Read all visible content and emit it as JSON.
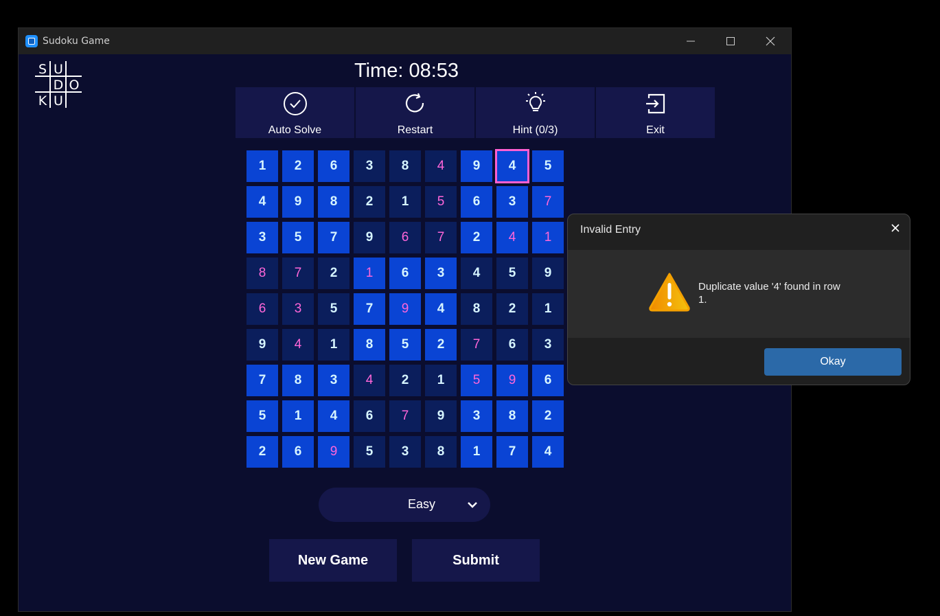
{
  "window": {
    "title": "Sudoku Game"
  },
  "logo": {
    "letters": [
      "S",
      "U",
      "D",
      "O",
      "K",
      "U"
    ]
  },
  "timer": {
    "text": "Time: 08:53"
  },
  "toolbar": {
    "auto_solve": "Auto Solve",
    "restart": "Restart",
    "hint": "Hint (0/3)",
    "exit": "Exit"
  },
  "board": {
    "selected_cell": {
      "row": 1,
      "col": 8
    },
    "rows": [
      [
        "1",
        "2",
        "6",
        "3",
        "8",
        "4",
        "9",
        "4",
        "5"
      ],
      [
        "4",
        "9",
        "8",
        "2",
        "1",
        "5",
        "6",
        "3",
        "7"
      ],
      [
        "3",
        "5",
        "7",
        "9",
        "6",
        "7",
        "2",
        "4",
        "1"
      ],
      [
        "8",
        "7",
        "2",
        "1",
        "6",
        "3",
        "4",
        "5",
        "9"
      ],
      [
        "6",
        "3",
        "5",
        "7",
        "9",
        "4",
        "8",
        "2",
        "1"
      ],
      [
        "9",
        "4",
        "1",
        "8",
        "5",
        "2",
        "7",
        "6",
        "3"
      ],
      [
        "7",
        "8",
        "3",
        "4",
        "2",
        "1",
        "5",
        "9",
        "6"
      ],
      [
        "5",
        "1",
        "4",
        "6",
        "7",
        "9",
        "3",
        "8",
        "2"
      ],
      [
        "2",
        "6",
        "9",
        "5",
        "3",
        "8",
        "1",
        "7",
        "4"
      ]
    ],
    "cell_types": [
      [
        "g",
        "g",
        "g",
        "d",
        "d",
        "u",
        "g",
        "g",
        "g"
      ],
      [
        "g",
        "g",
        "g",
        "d",
        "d",
        "u",
        "g",
        "g",
        "gu"
      ],
      [
        "g",
        "g",
        "g",
        "d",
        "u",
        "u",
        "g",
        "gu",
        "gu"
      ],
      [
        "u",
        "u",
        "d",
        "gu",
        "g",
        "g",
        "d",
        "d",
        "d"
      ],
      [
        "u",
        "u",
        "d",
        "g",
        "gu",
        "g",
        "d",
        "d",
        "d"
      ],
      [
        "d",
        "u",
        "d",
        "g",
        "g",
        "g",
        "u",
        "d",
        "d"
      ],
      [
        "g",
        "g",
        "g",
        "u",
        "d",
        "d",
        "gu",
        "gu",
        "g"
      ],
      [
        "g",
        "g",
        "g",
        "d",
        "u",
        "d",
        "g",
        "g",
        "g"
      ],
      [
        "g",
        "g",
        "gu",
        "d",
        "d",
        "d",
        "g",
        "g",
        "g"
      ]
    ]
  },
  "difficulty": {
    "selected": "Easy"
  },
  "buttons": {
    "new_game": "New Game",
    "submit": "Submit"
  },
  "dialog": {
    "title": "Invalid Entry",
    "message": "Duplicate value '4' found in row 1.",
    "ok": "Okay"
  },
  "colors": {
    "given_cell": "#0a44d4",
    "dark_cell": "#0b1e5c",
    "user_digit": "#ff66d9",
    "selection": "#ff5fd2"
  }
}
